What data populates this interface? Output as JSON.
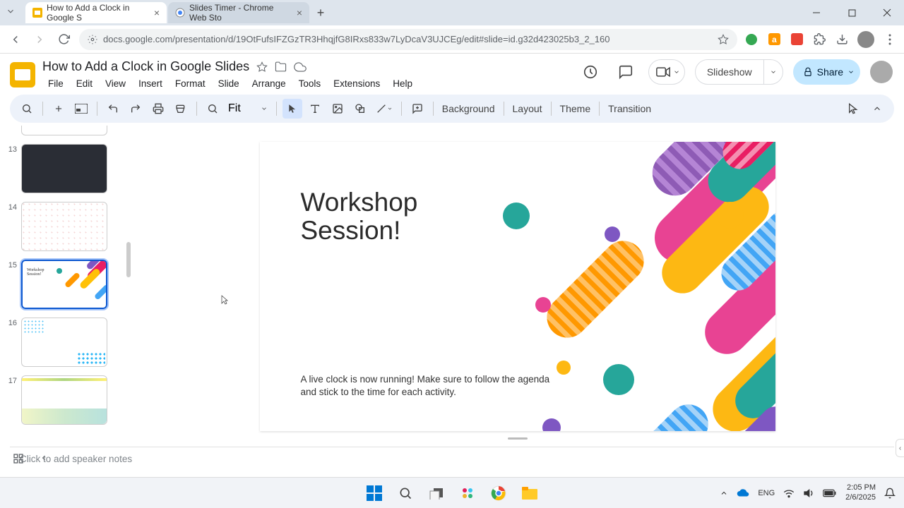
{
  "browser": {
    "tabs": [
      {
        "title": "How to Add a Clock in Google S",
        "active": true,
        "favicon": "slides"
      },
      {
        "title": "Slides Timer - Chrome Web Sto",
        "active": false,
        "favicon": "webstore"
      }
    ],
    "url": "docs.google.com/presentation/d/19OtFufsIFZGzTR3HhqjfG8IRxs833w7LyDcaV3UJCEg/edit#slide=id.g32d423025b3_2_160"
  },
  "doc": {
    "title": "How to Add a Clock in Google Slides",
    "menus": [
      "File",
      "Edit",
      "View",
      "Insert",
      "Format",
      "Slide",
      "Arrange",
      "Tools",
      "Extensions",
      "Help"
    ]
  },
  "header_buttons": {
    "slideshow": "Slideshow",
    "share": "Share"
  },
  "toolbar": {
    "zoom_label": "Fit",
    "text_buttons": [
      "Background",
      "Layout",
      "Theme",
      "Transition"
    ]
  },
  "filmstrip": {
    "visible_slides": [
      13,
      14,
      15,
      16,
      17
    ],
    "selected": 15
  },
  "slide": {
    "title_line1": "Workshop",
    "title_line2": "Session!",
    "body": "A live clock is now running! Make sure to follow the agenda and stick to the time for each activity."
  },
  "notes": {
    "placeholder": "Click to add speaker notes"
  },
  "taskbar": {
    "lang": "ENG",
    "time": "2:05 PM",
    "date": "2/6/2025"
  }
}
